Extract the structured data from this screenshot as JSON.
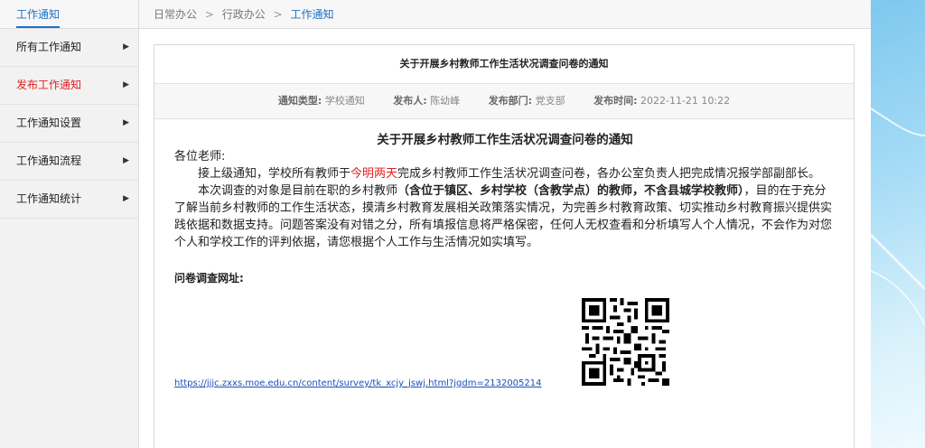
{
  "sidebar": {
    "header": "工作通知",
    "items": [
      {
        "label": "所有工作通知",
        "active": false
      },
      {
        "label": "发布工作通知",
        "active": true
      },
      {
        "label": "工作通知设置",
        "active": false
      },
      {
        "label": "工作通知流程",
        "active": false
      },
      {
        "label": "工作通知统计",
        "active": false
      }
    ]
  },
  "breadcrumb": {
    "items": [
      "日常办公",
      "行政办公",
      "工作通知"
    ],
    "separator": ">"
  },
  "notice": {
    "header_title": "关于开展乡村教师工作生活状况调查问卷的通知",
    "meta": {
      "type_label": "通知类型:",
      "type_value": "学校通知",
      "publisher_label": "发布人:",
      "publisher_value": "陈幼峰",
      "dept_label": "发布部门:",
      "dept_value": "党支部",
      "time_label": "发布时间:",
      "time_value": "2022-11-21 10:22"
    },
    "body_title": "关于开展乡村教师工作生活状况调查问卷的通知",
    "greeting": "各位老师:",
    "p1_a": "接上级通知，学校所有教师于",
    "p1_red": "今明两天",
    "p1_b": "完成乡村教师工作生活状况调查问卷，各办公室负责人把完成情况报学部副部长。",
    "p2_a": "本次调查的对象是目前在职的乡村教师",
    "p2_bold": "（含位于镇区、乡村学校（含教学点）的教师，不含县城学校教师）",
    "p2_b": "，目的在于充分了解当前乡村教师的工作生活状态，摸清乡村教育发展相关政策落实情况，为完善乡村教育政策、切实推动乡村教育振兴提供实践依据和数据支持。问题答案没有对错之分，所有填报信息将严格保密，任何人无权查看和分析填写人个人情况，不会作为对您个人和学校工作的评判依据，请您根据个人工作与生活情况如实填写。",
    "survey_label": "问卷调查网址:",
    "survey_url": "https://jjjc.zxxs.moe.edu.cn/content/survey/tk_xcjy_jswj.html?jgdm=2132005214"
  },
  "colors": {
    "accent": "#1a73c8",
    "active_menu": "#e02020",
    "highlight": "#e02020",
    "link": "#1a4fb8"
  },
  "icons": {
    "menu_arrow": "triangle-right-icon",
    "qr": "qr-code-icon"
  }
}
